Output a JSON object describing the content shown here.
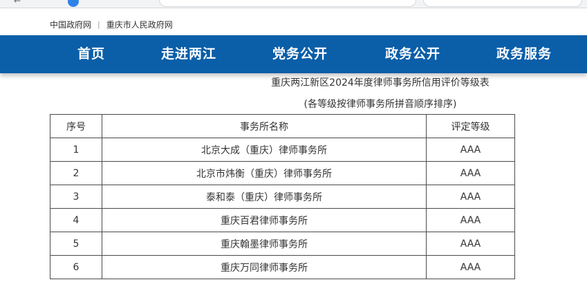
{
  "header": {
    "links": [
      "中国政府网",
      "重庆市人民政府网"
    ],
    "separator": "|"
  },
  "nav": {
    "items": [
      "首页",
      "走进两江",
      "党务公开",
      "政务公开",
      "政务服务"
    ]
  },
  "content": {
    "title": "重庆两江新区2024年度律师事务所信用评价等级表",
    "subtitle": "(各等级按律师事务所拼音顺序排序)",
    "table": {
      "headers": [
        "序号",
        "事务所名称",
        "评定等级"
      ],
      "rows": [
        [
          "1",
          "北京大成（重庆）律师事务所",
          "AAA"
        ],
        [
          "2",
          "北京市炜衡（重庆）律师事务所",
          "AAA"
        ],
        [
          "3",
          "泰和泰（重庆）律师事务所",
          "AAA"
        ],
        [
          "4",
          "重庆百君律师事务所",
          "AAA"
        ],
        [
          "5",
          "重庆翰墨律师事务所",
          "AAA"
        ],
        [
          "6",
          "重庆万同律师事务所",
          "AAA"
        ]
      ]
    }
  },
  "colors": {
    "nav_bg": "#0b5ea8",
    "nav_text": "#ffffff",
    "text": "#333333",
    "border": "#4a4a4a"
  }
}
